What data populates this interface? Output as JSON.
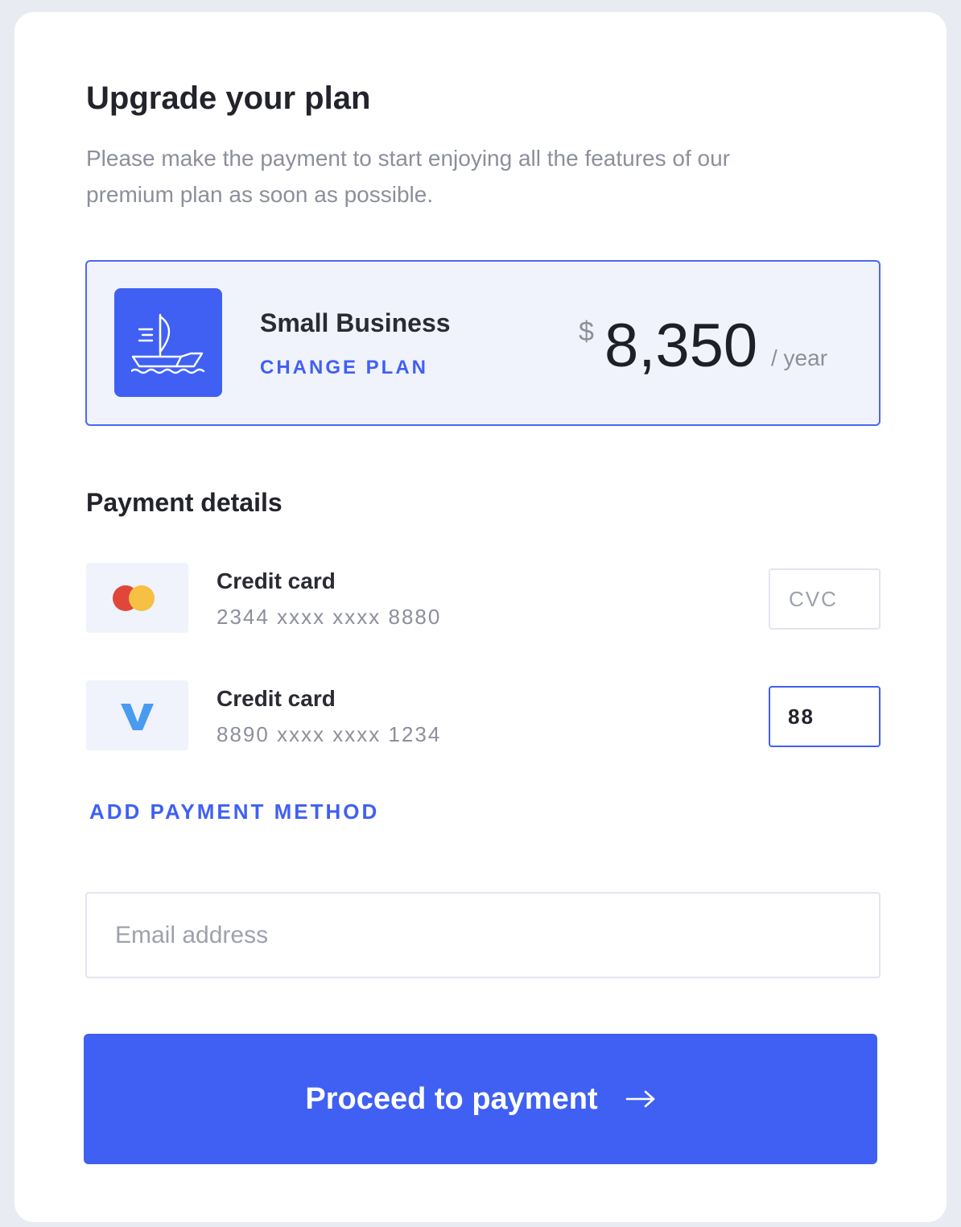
{
  "header": {
    "title": "Upgrade your plan",
    "subtitle": "Please make the payment to start enjoying all the features of our premium plan as soon as possible."
  },
  "plan": {
    "icon": "sailboat-icon",
    "name": "Small Business",
    "change_label": "CHANGE PLAN",
    "currency": "$",
    "amount": "8,350",
    "period": "/ year"
  },
  "payment": {
    "section_title": "Payment details",
    "methods": [
      {
        "icon": "mastercard-icon",
        "label": "Credit card",
        "number": "2344 xxxx xxxx 8880",
        "cvc_value": "",
        "cvc_placeholder": "CVC"
      },
      {
        "icon": "visa-icon",
        "label": "Credit card",
        "number": "8890 xxxx xxxx 1234",
        "cvc_value": "88",
        "cvc_placeholder": "CVC"
      }
    ],
    "add_label": "ADD PAYMENT METHOD"
  },
  "email": {
    "placeholder": "Email address",
    "value": ""
  },
  "proceed": {
    "label": "Proceed to payment",
    "icon": "arrow-right-icon"
  },
  "colors": {
    "accent": "#3f60f3",
    "plan_bg": "#f1f3fc",
    "mastercard_red": "#e0473a",
    "mastercard_yellow": "#f5c043",
    "visa_blue": "#4a9bf0"
  }
}
